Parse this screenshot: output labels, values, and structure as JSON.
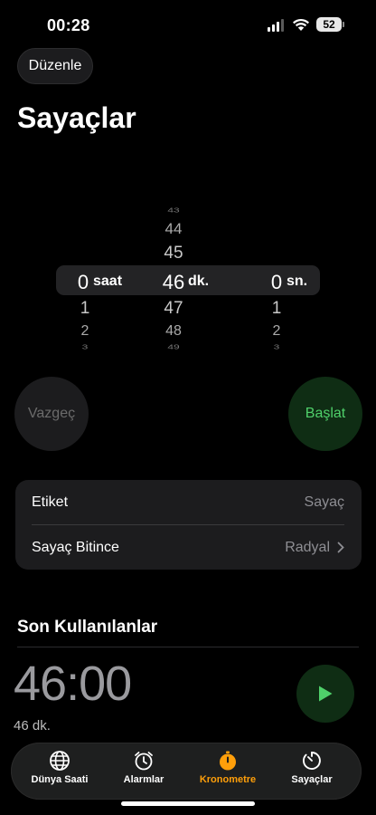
{
  "status_bar": {
    "time": "00:28",
    "battery": "52"
  },
  "header": {
    "edit_label": "Düzenle",
    "title": "Sayaçlar"
  },
  "picker": {
    "hours": {
      "above": [],
      "selected": "0",
      "below": [
        "1",
        "2",
        "3"
      ],
      "unit": "saat"
    },
    "minutes": {
      "above": [
        "43",
        "44",
        "45"
      ],
      "selected": "46",
      "below": [
        "47",
        "48",
        "49"
      ],
      "unit": "dk."
    },
    "seconds": {
      "above": [],
      "selected": "0",
      "below": [
        "1",
        "2",
        "3"
      ],
      "unit": "sn."
    }
  },
  "buttons": {
    "cancel_label": "Vazgeç",
    "start_label": "Başlat"
  },
  "settings": {
    "label_row": {
      "title": "Etiket",
      "value": "Sayaç"
    },
    "end_row": {
      "title": "Sayaç Bitince",
      "value": "Radyal"
    }
  },
  "recents": {
    "section_title": "Son Kullanılanlar",
    "items": [
      {
        "time": "46:00",
        "label": "46 dk."
      }
    ]
  },
  "tabs": [
    {
      "label": "Dünya Saati",
      "icon": "globe-icon"
    },
    {
      "label": "Alarmlar",
      "icon": "alarm-icon"
    },
    {
      "label": "Kronometre",
      "icon": "stopwatch-icon",
      "active": true
    },
    {
      "label": "Sayaçlar",
      "icon": "timer-icon"
    }
  ],
  "colors": {
    "accent_green": "#4fd06a",
    "active_tab": "#ff9f0a",
    "background": "#000000"
  }
}
